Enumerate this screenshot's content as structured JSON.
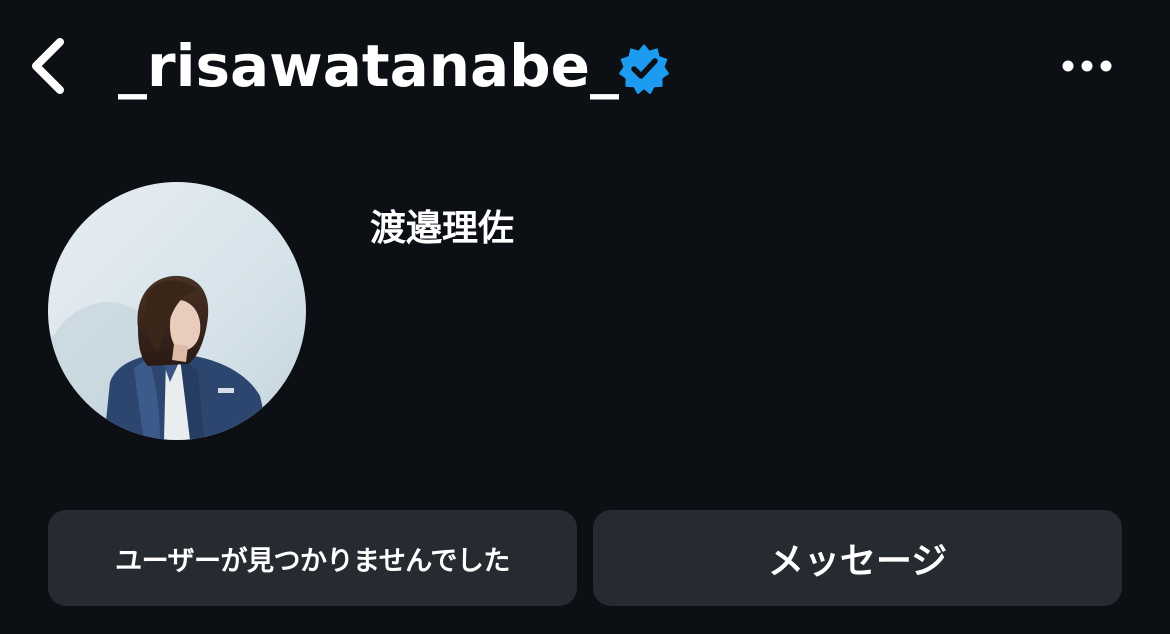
{
  "header": {
    "back_icon": "chevron-left-icon",
    "username": "_risawatanabe_",
    "verified_icon": "verified-badge-icon",
    "more_icon": "more-horizontal-icon"
  },
  "profile": {
    "avatar": "profile-photo",
    "display_name": "渡邉理佐"
  },
  "actions": {
    "follow_status_label": "ユーザーが見つかりませんでした",
    "message_label": "メッセージ"
  },
  "colors": {
    "background": "#0c0f14",
    "button_bg": "#262a31",
    "verified": "#1d9bf0",
    "text": "#ffffff"
  }
}
